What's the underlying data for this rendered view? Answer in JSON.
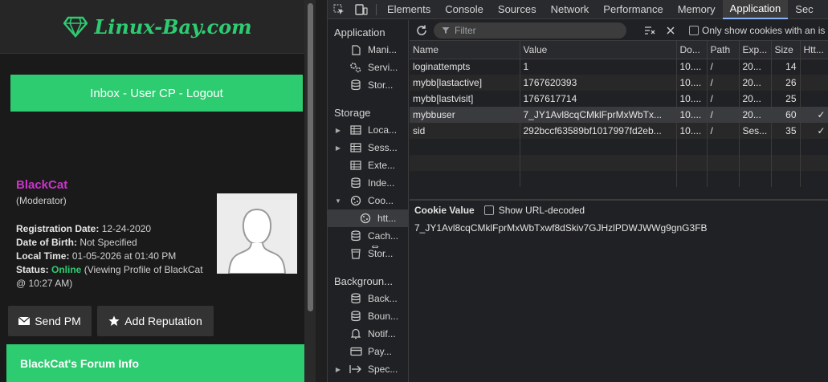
{
  "site": {
    "logo_text": "Linux-Bay.com",
    "nav_links": "Inbox - User CP - Logout",
    "profile": {
      "username": "BlackCat",
      "role": "(Moderator)",
      "reg_label": "Registration Date:",
      "reg_value": "12-24-2020",
      "dob_label": "Date of Birth:",
      "dob_value": "Not Specified",
      "local_label": "Local Time:",
      "local_value": "01-05-2026 at 01:40 PM",
      "status_label": "Status:",
      "status_value": "Online",
      "status_detail_1": "(Viewing Profile of ",
      "status_user": "BlackCat",
      "status_detail_2": " @ 10:27 AM)"
    },
    "send_pm": "Send PM",
    "add_rep": "Add Reputation",
    "forum_info": "BlackCat's Forum Info",
    "colors": {
      "accent": "#2ecc71",
      "username": "#cc33cc"
    }
  },
  "devtools": {
    "tabs": [
      "Elements",
      "Console",
      "Sources",
      "Network",
      "Performance",
      "Memory",
      "Application",
      "Sec"
    ],
    "active_tab": "Application",
    "sidebar": {
      "app_header": "Application",
      "app_items": [
        "Mani...",
        "Servi...",
        "Stor..."
      ],
      "storage_header": "Storage",
      "storage_items": [
        "Loca...",
        "Sess...",
        "Exte...",
        "Inde...",
        "Coo..."
      ],
      "cookie_child": "htt...",
      "storage_items_2": [
        "Cach...",
        "Stor..."
      ],
      "bg_header": "Backgroun...",
      "bg_items": [
        "Back...",
        "Boun...",
        "Notif...",
        "Pay...",
        "Spec..."
      ]
    },
    "toolbar": {
      "filter_placeholder": "Filter",
      "only_show": "Only show cookies with an is"
    },
    "columns": [
      "Name",
      "Value",
      "Do...",
      "Path",
      "Exp...",
      "Size",
      "Htt..."
    ],
    "rows": [
      {
        "name": "loginattempts",
        "value": "1",
        "domain": "10....",
        "path": "/",
        "expires": "20...",
        "size": "14",
        "http": ""
      },
      {
        "name": "mybb[lastactive]",
        "value": "1767620393",
        "domain": "10....",
        "path": "/",
        "expires": "20...",
        "size": "26",
        "http": ""
      },
      {
        "name": "mybb[lastvisit]",
        "value": "1767617714",
        "domain": "10....",
        "path": "/",
        "expires": "20...",
        "size": "25",
        "http": ""
      },
      {
        "name": "mybbuser",
        "value": "7_JY1Avl8cqCMklFprMxWbTx...",
        "domain": "10....",
        "path": "/",
        "expires": "20...",
        "size": "60",
        "http": "✓"
      },
      {
        "name": "sid",
        "value": "292bccf63589bf1017997fd2eb...",
        "domain": "10....",
        "path": "/",
        "expires": "Ses...",
        "size": "35",
        "http": "✓"
      }
    ],
    "cookie_value_label": "Cookie Value",
    "show_decoded": "Show URL-decoded",
    "cookie_value": "7_JY1Avl8cqCMklFprMxWbTxwf8dSkiv7GJHzlPDWJWWg9gnG3FB"
  }
}
